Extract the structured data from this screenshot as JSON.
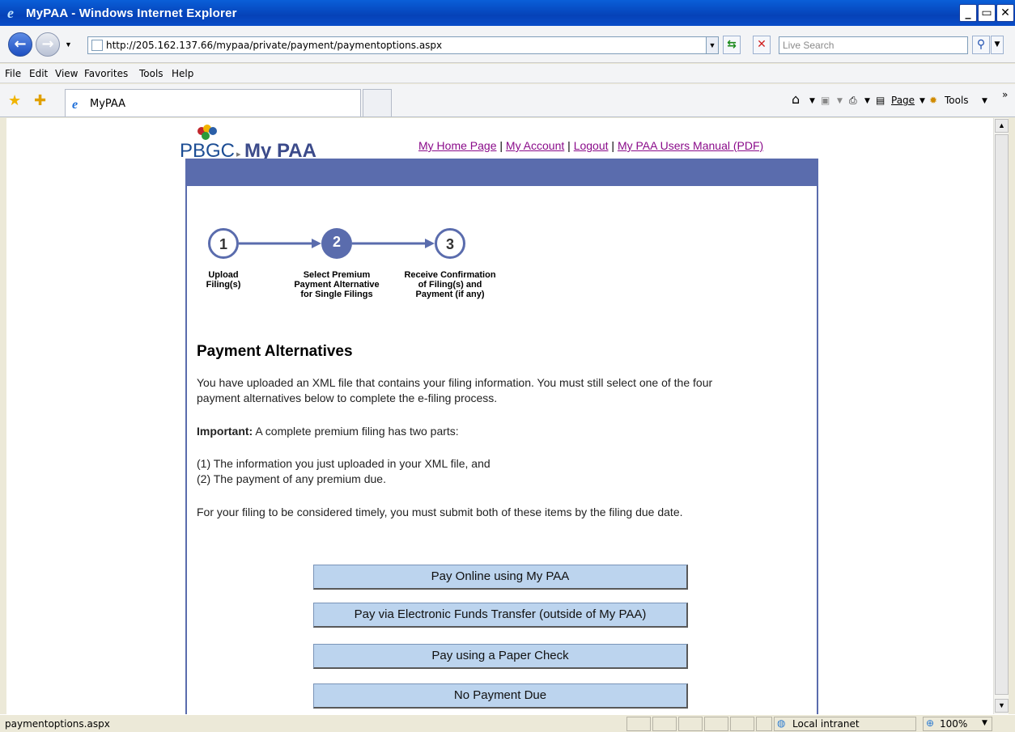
{
  "window": {
    "title": "MyPAA - Windows Internet Explorer"
  },
  "address": {
    "url": "http://205.162.137.66/mypaa/private/payment/paymentoptions.aspx"
  },
  "search": {
    "placeholder": "Live Search"
  },
  "menu": [
    "File",
    "Edit",
    "View",
    "Favorites",
    "Tools",
    "Help"
  ],
  "tab": {
    "label": "MyPAA"
  },
  "commandbar": {
    "page": "Page",
    "tools": "Tools"
  },
  "logo": {
    "pbgc": "PBGC",
    "mypaa": "My PAA"
  },
  "toplinks": {
    "home": "My Home Page",
    "account": "My Account",
    "logout": "Logout",
    "manual": "My PAA Users Manual (PDF)",
    "sep": " | "
  },
  "steps": [
    {
      "num": "1",
      "label_lines": [
        "Upload",
        "Filing(s)"
      ]
    },
    {
      "num": "2",
      "label_lines": [
        "Select Premium",
        "Payment Alternative",
        "for Single Filings"
      ]
    },
    {
      "num": "3",
      "label_lines": [
        "Receive Confirmation",
        "of Filing(s) and",
        "Payment (if any)"
      ]
    }
  ],
  "heading": "Payment Alternatives",
  "paragraphs": {
    "intro_1": "You have uploaded an XML file that contains your filing information. You must still select one of the four",
    "intro_2": "payment alternatives below to complete the e-filing process.",
    "important_label": "Important:",
    "important_text": " A complete premium filing has two parts:",
    "part1": "(1) The information you just uploaded in your XML file, and",
    "part2": "(2) The payment of any premium due.",
    "timely": "For your filing to be considered timely, you must submit both of these items by the filing due date."
  },
  "buttons": {
    "online": "Pay Online using My PAA",
    "eft": "Pay via Electronic Funds Transfer (outside of My PAA)",
    "check": "Pay using a Paper Check",
    "none": "No Payment Due"
  },
  "status": {
    "text": "paymentoptions.aspx",
    "zone": "Local intranet",
    "zoom": "100%"
  },
  "colors": {
    "accent": "#5a6cad",
    "button": "#bcd4ee",
    "link": "#8a0b8a"
  }
}
